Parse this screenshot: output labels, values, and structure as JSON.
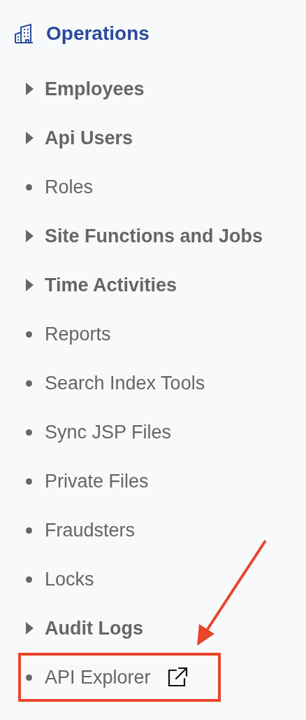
{
  "section": {
    "title": "Operations"
  },
  "items": [
    {
      "label": "Employees",
      "kind": "group",
      "expanded": false
    },
    {
      "label": "Api Users",
      "kind": "group",
      "expanded": false
    },
    {
      "label": "Roles",
      "kind": "link"
    },
    {
      "label": "Site Functions and Jobs",
      "kind": "group",
      "expanded": false
    },
    {
      "label": "Time Activities",
      "kind": "group",
      "expanded": false
    },
    {
      "label": "Reports",
      "kind": "link"
    },
    {
      "label": "Search Index Tools",
      "kind": "link"
    },
    {
      "label": "Sync JSP Files",
      "kind": "link"
    },
    {
      "label": "Private Files",
      "kind": "link"
    },
    {
      "label": "Fraudsters",
      "kind": "link"
    },
    {
      "label": "Locks",
      "kind": "link"
    },
    {
      "label": "Audit Logs",
      "kind": "group",
      "expanded": false
    },
    {
      "label": "API Explorer",
      "kind": "link",
      "highlighted": true,
      "external": true
    }
  ]
}
